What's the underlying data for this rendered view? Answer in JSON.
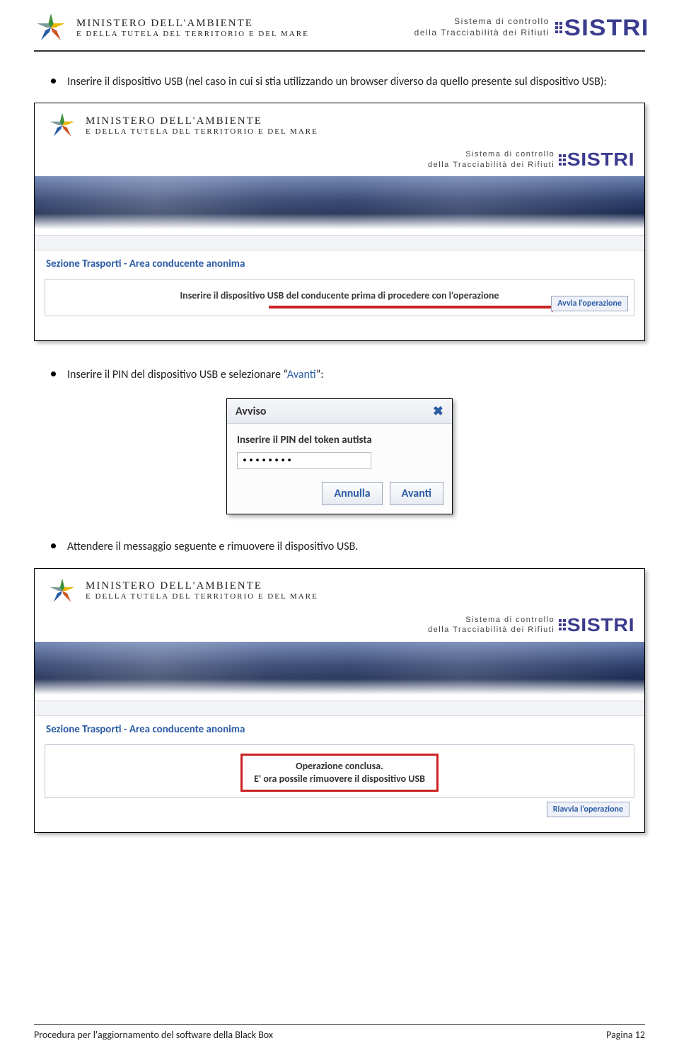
{
  "header": {
    "ministry_line1": "MINISTERO DELL'AMBIENTE",
    "ministry_line2": "E DELLA TUTELA DEL TERRITORIO E DEL MARE",
    "sistri_line1": "Sistema di controllo",
    "sistri_line2": "della Tracciabilità dei Rifiuti",
    "sistri_brand": "SISTRI"
  },
  "bullets": {
    "b1_pre": "Inserire il dispositivo USB (nel caso in cui si stia utilizzando un browser diverso da quello presente sul dispositivo USB):",
    "b2_pre": "Inserire il PIN del dispositivo USB e selezionare “",
    "b2_emph": "Avanti",
    "b2_post": "”:",
    "b3": "Attendere il messaggio seguente e rimuovere il dispositivo USB."
  },
  "shot1": {
    "section": "Sezione Trasporti - Area conducente anonima",
    "msg": "Inserire il dispositivo USB del conducente prima di procedere con l'operazione",
    "btn": "Avvia l'operazione"
  },
  "dialog": {
    "title": "Avviso",
    "label": "Inserire il PIN del token autista",
    "value": "••••••••",
    "cancel": "Annulla",
    "ok": "Avanti"
  },
  "shot2": {
    "section": "Sezione Trasporti - Area conducente anonima",
    "done1": "Operazione conclusa.",
    "done2": "E' ora possile rimuovere il dispositivo USB",
    "btn": "Riavvia l'operazione"
  },
  "footer": {
    "left": "Procedura per l'aggiornamento del software della Black Box",
    "right": "Pagina 12"
  }
}
